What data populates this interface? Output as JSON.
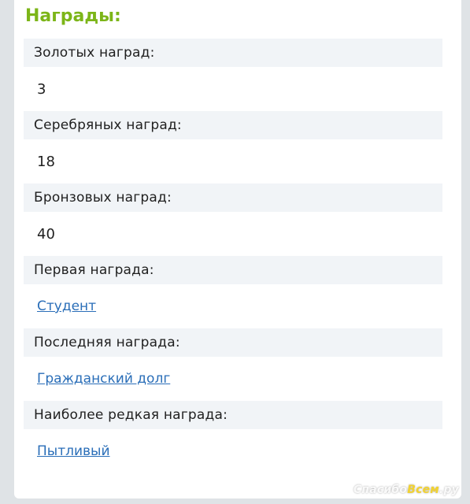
{
  "section": {
    "title": "Награды:"
  },
  "awards": [
    {
      "label": "Золотых наград:",
      "value": "3",
      "is_link": false
    },
    {
      "label": "Серебряных наград:",
      "value": "18",
      "is_link": false
    },
    {
      "label": "Бронзовых наград:",
      "value": "40",
      "is_link": false
    },
    {
      "label": "Первая награда:",
      "value": "Студент",
      "is_link": true
    },
    {
      "label": "Последняя награда:",
      "value": "Гражданский долг",
      "is_link": true
    },
    {
      "label": "Наиболее редкая награда:",
      "value": "Пытливый",
      "is_link": true
    }
  ],
  "watermark": {
    "text_main": "Спасибо",
    "text_accent": "Всем",
    "text_suffix": ".ру"
  },
  "colors": {
    "title": "#7cb518",
    "label_bg": "#f1f4f7",
    "link": "#2a6eb8",
    "page_bg": "#dfe3e6"
  }
}
